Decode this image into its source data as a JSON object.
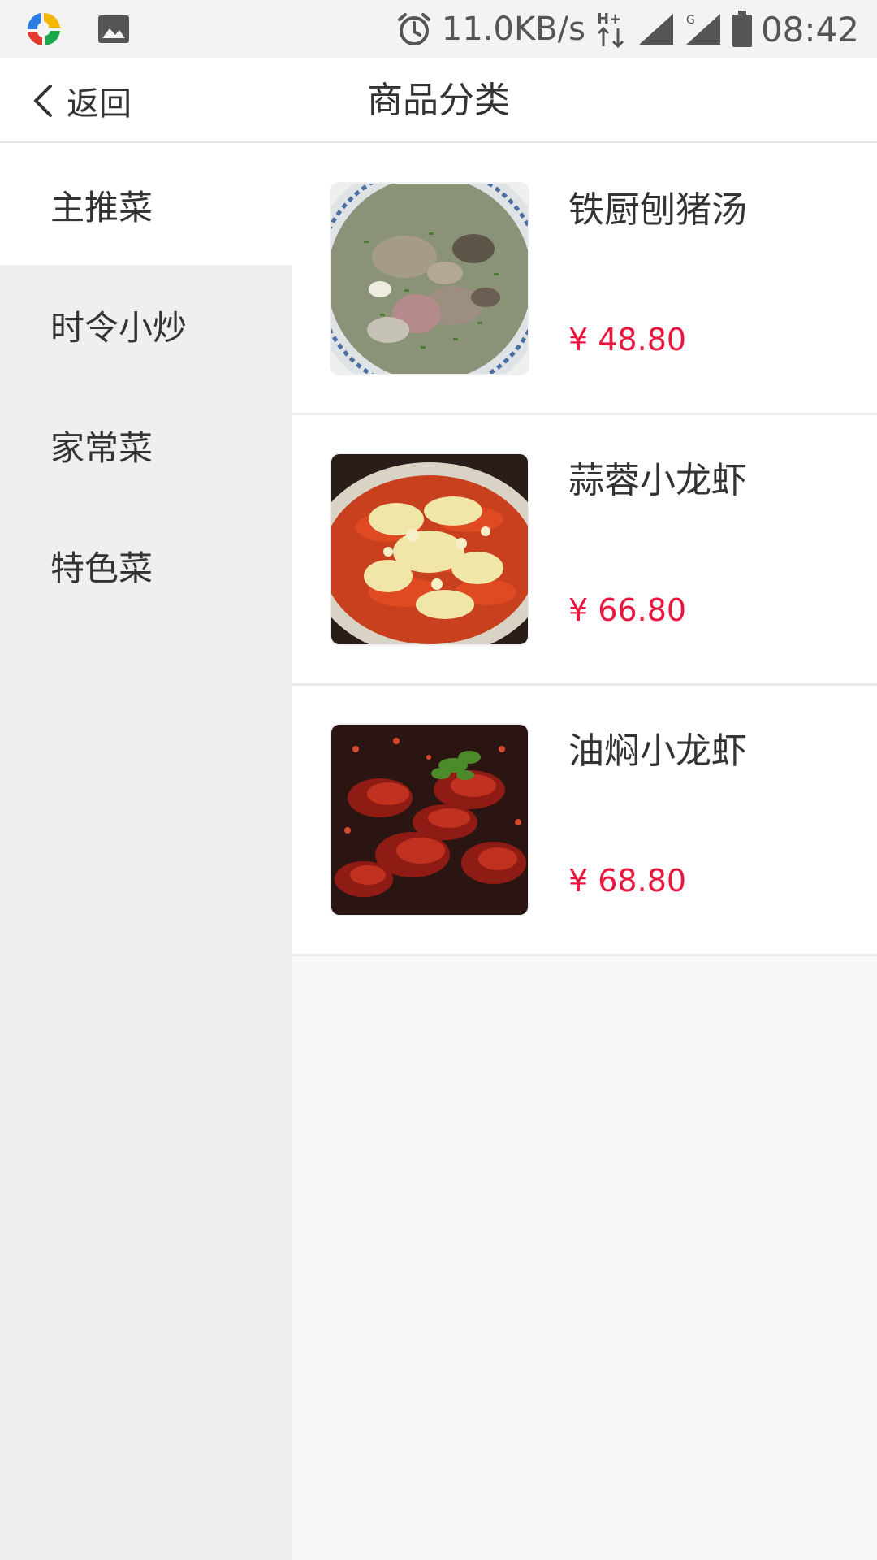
{
  "status_bar": {
    "net_speed": "11.0KB/s",
    "network_type": "H+",
    "signal_label": "G",
    "time": "08:42",
    "icons": [
      "app-logo-icon",
      "gallery-icon",
      "alarm-icon",
      "hplus-data-icon",
      "signal-icon",
      "battery-icon"
    ]
  },
  "header": {
    "back_label": "返回",
    "title": "商品分类"
  },
  "sidebar": {
    "items": [
      {
        "label": "主推菜",
        "active": true
      },
      {
        "label": "时令小炒",
        "active": false
      },
      {
        "label": "家常菜",
        "active": false
      },
      {
        "label": "特色菜",
        "active": false
      }
    ]
  },
  "products": [
    {
      "name": "铁厨刨猪汤",
      "price": "¥ 48.80",
      "image": "pork-soup"
    },
    {
      "name": "蒜蓉小龙虾",
      "price": "¥ 66.80",
      "image": "garlic-crayfish"
    },
    {
      "name": "油焖小龙虾",
      "price": "¥ 68.80",
      "image": "braised-crayfish"
    }
  ],
  "colors": {
    "price": "#e8173f",
    "sidebar_bg": "#efefef",
    "active_item_bg": "#ffffff"
  }
}
